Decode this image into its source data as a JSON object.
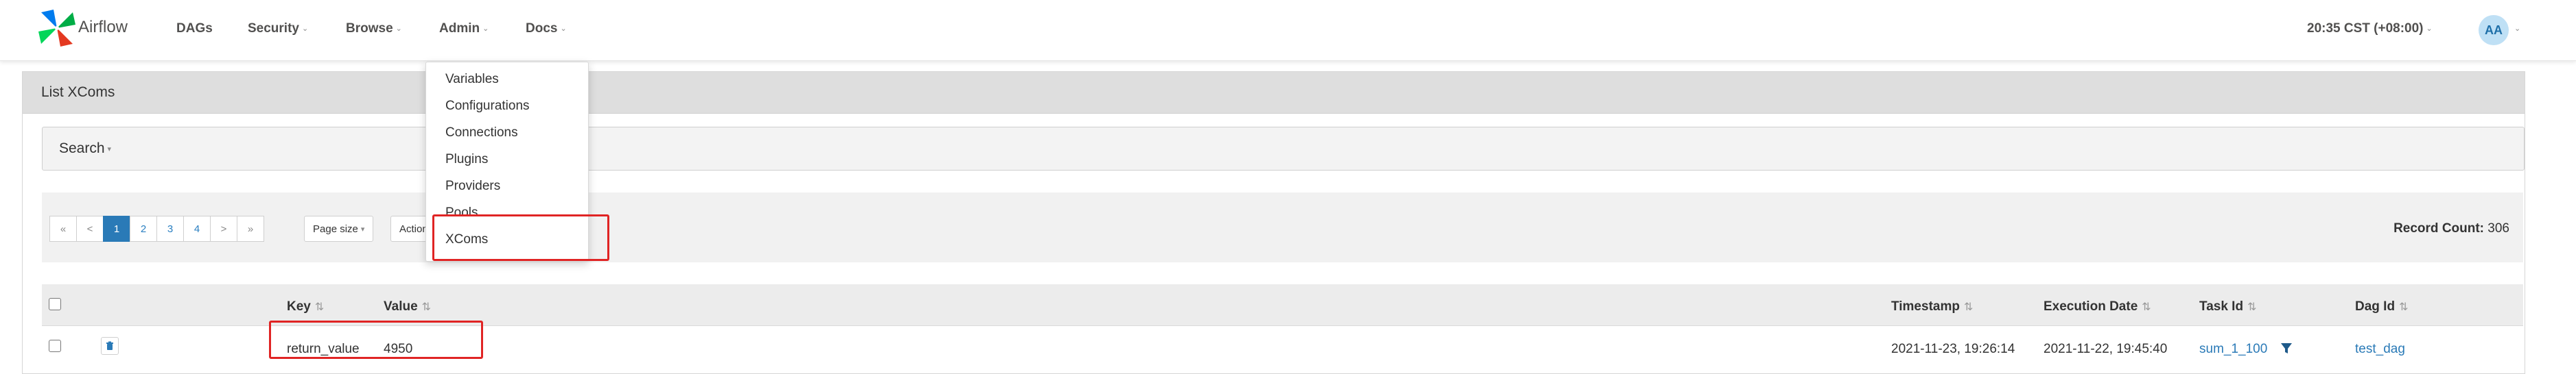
{
  "navbar": {
    "brand": "Airflow",
    "items": [
      {
        "label": "DAGs",
        "has_caret": false
      },
      {
        "label": "Security",
        "has_caret": true
      },
      {
        "label": "Browse",
        "has_caret": true
      },
      {
        "label": "Admin",
        "has_caret": true
      },
      {
        "label": "Docs",
        "has_caret": true
      }
    ],
    "time": "20:35 CST (+08:00)",
    "avatar_initials": "AA"
  },
  "admin_menu": {
    "items": [
      "Variables",
      "Configurations",
      "Connections",
      "Plugins",
      "Providers",
      "Pools",
      "XComs"
    ],
    "highlighted": "XComs"
  },
  "panel": {
    "title": "List XComs",
    "search_label": "Search"
  },
  "pagination": {
    "first": "«",
    "prev": "<",
    "pages": [
      "1",
      "2",
      "3",
      "4"
    ],
    "current_page": "1",
    "next": ">",
    "last": "»",
    "page_size_label": "Page size",
    "actions_label": "Actions"
  },
  "record_count": {
    "label": "Record Count:",
    "value": "306"
  },
  "table": {
    "columns": [
      "Key",
      "Value",
      "Timestamp",
      "Execution Date",
      "Task Id",
      "Dag Id"
    ],
    "rows": [
      {
        "key": "return_value",
        "value": "4950",
        "timestamp": "2021-11-23, 19:26:14",
        "execution_date": "2021-11-22, 19:45:40",
        "task_id": "sum_1_100",
        "dag_id": "test_dag"
      }
    ]
  },
  "colors": {
    "accent": "#2a7ab7",
    "highlight_box": "#e02424",
    "brand_blue": "#017cee"
  },
  "icons": [
    "airflow-logo",
    "trash-icon",
    "filter-icon",
    "sort-icon",
    "chevron-down-icon"
  ]
}
